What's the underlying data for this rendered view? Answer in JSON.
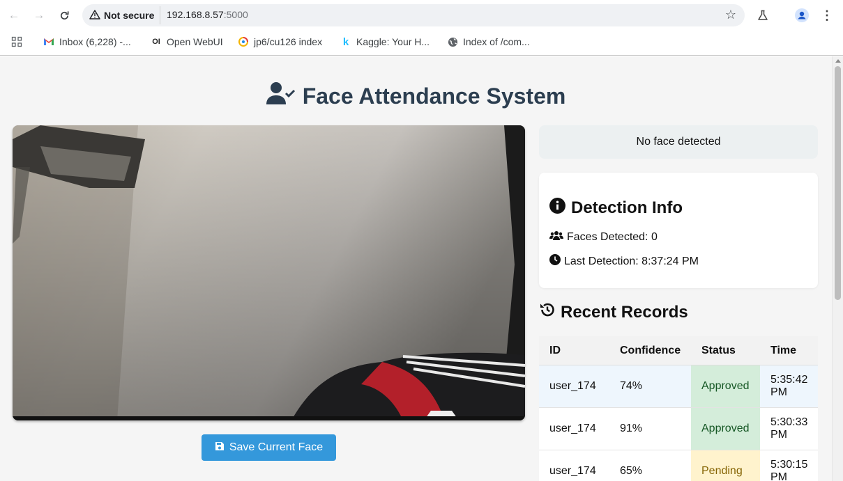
{
  "browser": {
    "security_label": "Not secure",
    "url_host": "192.168.8.57",
    "url_port": ":5000",
    "bookmarks": [
      {
        "label": "Inbox (6,228) -...",
        "icon": "gmail-icon"
      },
      {
        "label": "Open WebUI",
        "icon": "openwebui-icon"
      },
      {
        "label": "jp6/cu126 index",
        "icon": "jp6-icon"
      },
      {
        "label": "Kaggle: Your H...",
        "icon": "kaggle-icon"
      },
      {
        "label": "Index of /com...",
        "icon": "globe-icon"
      }
    ]
  },
  "app": {
    "title": "Face Attendance System",
    "save_button": "Save Current Face",
    "status": "No face detected"
  },
  "detection": {
    "heading": "Detection Info",
    "faces_label": "Faces Detected: 0",
    "last_label": "Last Detection: 8:37:24 PM"
  },
  "records": {
    "heading": "Recent Records",
    "columns": [
      "ID",
      "Confidence",
      "Status",
      "Time"
    ],
    "rows": [
      {
        "id": "user_174",
        "confidence": "74%",
        "status": "Approved",
        "time": "5:35:42 PM"
      },
      {
        "id": "user_174",
        "confidence": "91%",
        "status": "Approved",
        "time": "5:30:33 PM"
      },
      {
        "id": "user_174",
        "confidence": "65%",
        "status": "Pending",
        "time": "5:30:15 PM"
      }
    ]
  },
  "colors": {
    "title": "#2c3e50",
    "button": "#3498db",
    "approved_bg": "#d4edda",
    "pending_bg": "#fff3cd"
  }
}
